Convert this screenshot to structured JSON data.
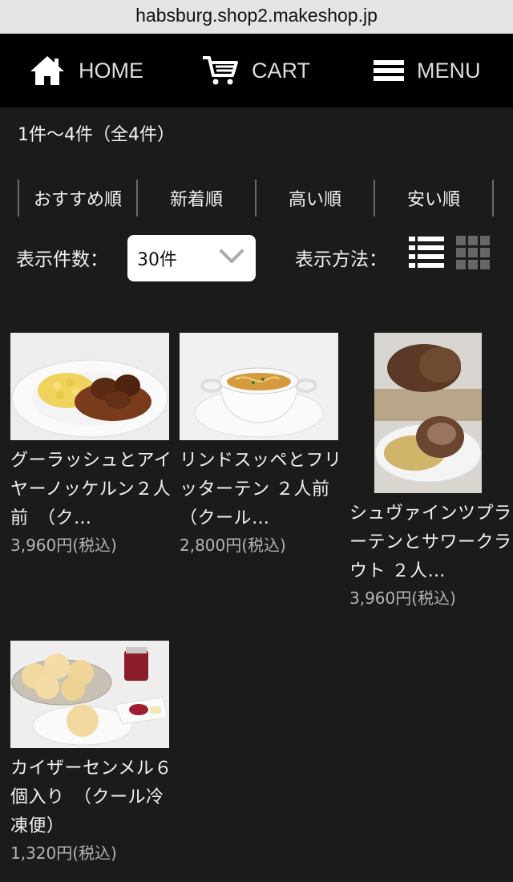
{
  "browser": {
    "url": "habsburg.shop2.makeshop.jp"
  },
  "nav": {
    "home": {
      "label": "HOME",
      "icon": "home-icon"
    },
    "cart": {
      "label": "CART",
      "icon": "cart-icon"
    },
    "menu": {
      "label": "MENU",
      "icon": "hamburger-menu-icon"
    }
  },
  "results": {
    "count_text": "1件〜4件（全4件）"
  },
  "sort": {
    "options": [
      "おすすめ順",
      "新着順",
      "高い順",
      "安い順"
    ]
  },
  "display": {
    "count_label": "表示件数：",
    "count_value": "30件",
    "method_label": "表示方法：",
    "method_icons": [
      "list-view-icon",
      "grid-view-icon"
    ]
  },
  "products": [
    {
      "name": "グーラッシュとアイヤーノッケルン２人前　（ク…",
      "price": "3,960円(税込)"
    },
    {
      "name": "リンドスッペとフリッターテン ２人前　（クール…",
      "price": "2,800円(税込)"
    },
    {
      "name": "シュヴァインツプラーテンとサワークラウト ２人…",
      "price": "3,960円(税込)"
    },
    {
      "name": "カイザーセンメル６個入り　（クール冷凍便）",
      "price": "1,320円(税込)"
    }
  ],
  "colors": {
    "background": "#1b1c1a",
    "nav_background": "#000000",
    "price_text": "#b3b3b3"
  }
}
